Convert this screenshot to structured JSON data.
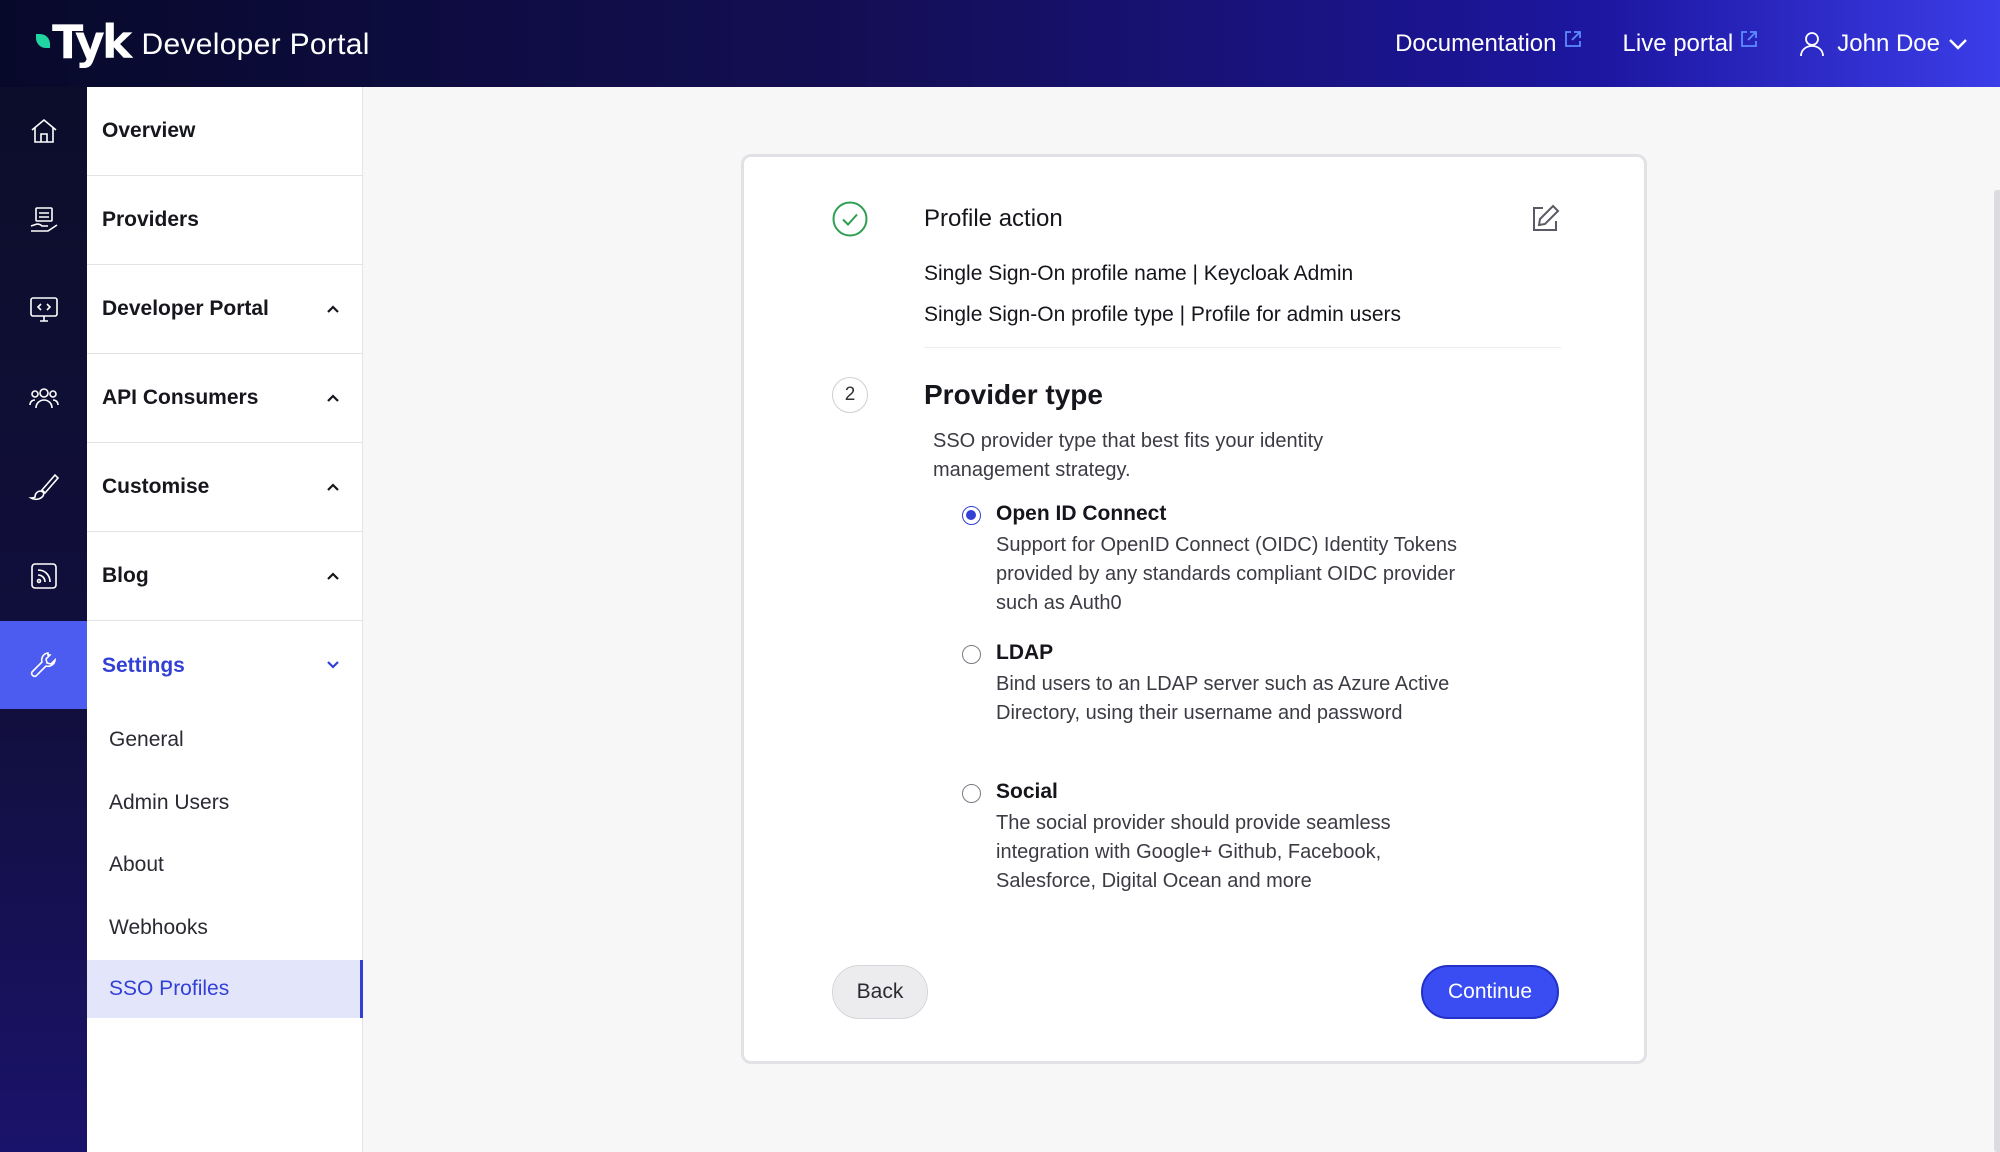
{
  "app": {
    "logo_word": "Tyk",
    "logo_sub": "Developer Portal"
  },
  "topnav": {
    "documentation": "Documentation",
    "live_portal": "Live portal",
    "user": "John Doe"
  },
  "sidebar": {
    "items": [
      {
        "label": "Overview"
      },
      {
        "label": "Providers"
      },
      {
        "label": "Developer Portal"
      },
      {
        "label": "API Consumers"
      },
      {
        "label": "Customise"
      },
      {
        "label": "Blog"
      },
      {
        "label": "Settings"
      }
    ],
    "settings_sub": [
      {
        "label": "General"
      },
      {
        "label": "Admin Users"
      },
      {
        "label": "About"
      },
      {
        "label": "Webhooks"
      },
      {
        "label": "SSO Profiles"
      }
    ]
  },
  "wizard": {
    "step1": {
      "title": "Profile action",
      "summary": [
        "Single Sign-On profile name | Keycloak Admin",
        "Single Sign-On profile type | Profile for admin users"
      ]
    },
    "step2": {
      "number": "2",
      "title": "Provider type",
      "description": "SSO provider type that best fits your identity management strategy.",
      "options": [
        {
          "title": "Open ID Connect",
          "description": "Support for OpenID Connect (OIDC) Identity Tokens provided by any standards compliant OIDC provider such as Auth0",
          "selected": true
        },
        {
          "title": "LDAP",
          "description": "Bind users to an LDAP server such as Azure Active Directory, using their username and password",
          "selected": false
        },
        {
          "title": "Social",
          "description": "The social provider should provide seamless integration with Google+ Github, Facebook, Salesforce, Digital Ocean and more",
          "selected": false
        }
      ]
    },
    "buttons": {
      "back": "Back",
      "continue": "Continue"
    }
  },
  "colors": {
    "accent": "#3a4df2",
    "active_text": "#3340d6",
    "success": "#2e9e52",
    "logo_leaf": "#20d5a2"
  }
}
